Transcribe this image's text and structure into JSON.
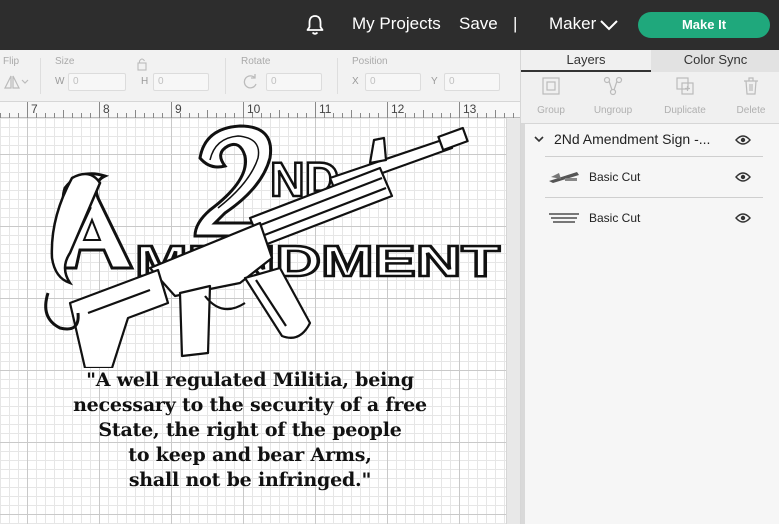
{
  "header": {
    "projects_label": "My Projects",
    "save_label": "Save",
    "divider": "|",
    "machine_label": "Maker",
    "make_it_label": "Make It"
  },
  "toolbar": {
    "flip_label": "Flip",
    "size_label": "Size",
    "w_label": "W",
    "h_label": "H",
    "w_value": "0",
    "h_value": "0",
    "rotate_label": "Rotate",
    "rotate_value": "0",
    "position_label": "Position",
    "x_label": "X",
    "y_label": "Y",
    "x_value": "0",
    "y_value": "0"
  },
  "ruler": {
    "marks": [
      "7",
      "8",
      "9",
      "10",
      "11",
      "12",
      "13"
    ]
  },
  "design": {
    "quote": "\"A well regulated Militia, being\nnecessary to the security of a free\nState, the right of the people\nto keep and bear Arms,\nshall not be infringed.\""
  },
  "panel": {
    "tabs": [
      {
        "label": "Layers",
        "active": true
      },
      {
        "label": "Color Sync",
        "active": false
      }
    ],
    "actions": [
      {
        "label": "Group",
        "icon": "group-icon"
      },
      {
        "label": "Ungroup",
        "icon": "ungroup-icon"
      },
      {
        "label": "Duplicate",
        "icon": "duplicate-icon"
      },
      {
        "label": "Delete",
        "icon": "trash-icon"
      }
    ],
    "group_name": "2Nd Amendment Sign -...",
    "layers": [
      {
        "name": "Basic Cut"
      },
      {
        "name": "Basic Cut"
      }
    ]
  },
  "colors": {
    "topbar": "#2d2d2d",
    "accent": "#1fa87c",
    "panel": "#f0f0f0"
  }
}
